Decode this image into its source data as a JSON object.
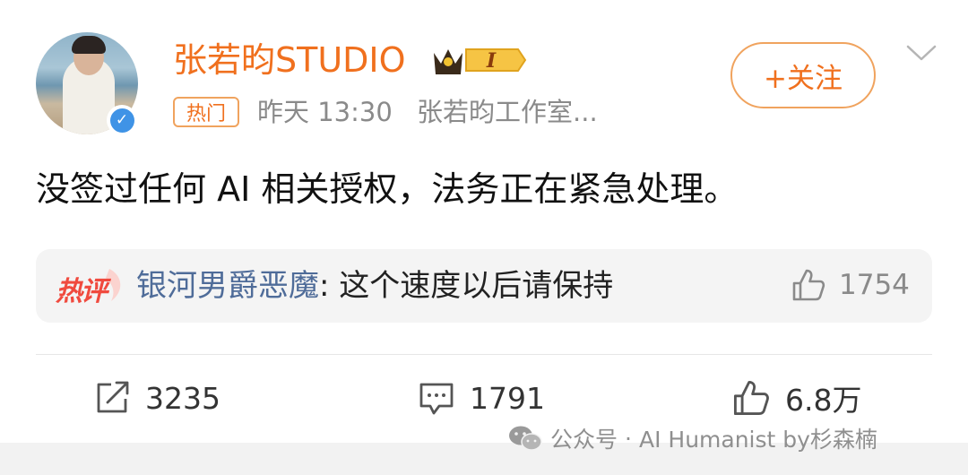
{
  "post": {
    "account_name": "张若昀STUDIO",
    "badge_level": "I",
    "hot_tag": "热门",
    "time": "昨天 13:30",
    "source": "张若昀工作室...",
    "follow_label": "+关注",
    "content": "没签过任何 AI 相关授权，法务正在紧急处理。"
  },
  "hot_comment": {
    "tag": "热评",
    "user": "银河男爵恶魔",
    "separator": ": ",
    "text": "这个速度以后请保持",
    "likes": "1754"
  },
  "actions": {
    "reposts": "3235",
    "comments": "1791",
    "likes": "6.8万"
  },
  "watermark": {
    "label": "公众号",
    "separator": "·",
    "author": "AI Humanist by杉森楠"
  },
  "colors": {
    "brand_orange": "#f0701e",
    "verified_blue": "#3f93e6",
    "hot_red": "#f04a3e",
    "comment_user": "#4f6c99"
  }
}
